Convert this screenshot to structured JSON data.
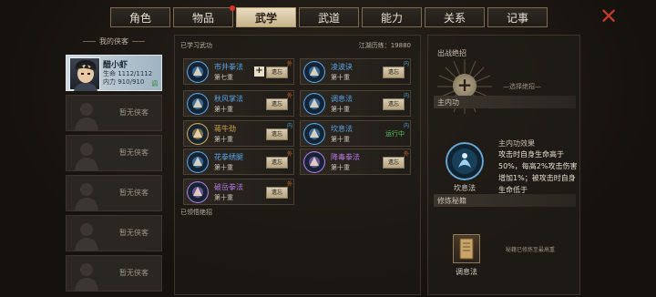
{
  "tabs": [
    {
      "label": "角色",
      "active": false
    },
    {
      "label": "物品",
      "active": false,
      "notify": true
    },
    {
      "label": "武学",
      "active": true
    },
    {
      "label": "武道",
      "active": false
    },
    {
      "label": "能力",
      "active": false
    },
    {
      "label": "关系",
      "active": false
    },
    {
      "label": "记事",
      "active": false
    }
  ],
  "roster": {
    "title": "我的侠客",
    "hero": {
      "name": "醋小虾",
      "hp": "生命 1112/1112",
      "mp": "内力 910/910",
      "tag": "调"
    },
    "empty_label": "暂无侠客"
  },
  "skills_panel": {
    "header": "已学习武功",
    "stat": "江湖历练：19880",
    "forget_label": "遗忘",
    "wai_tag": "外",
    "nei_tag": "内",
    "skills": [
      {
        "name": "市井拳法",
        "level": "第七重",
        "type": "外",
        "color": "#5aa5e6",
        "status": "forget",
        "plus": true
      },
      {
        "name": "凌波诀",
        "level": "第十重",
        "type": "内",
        "color": "#5aa5e6",
        "status": "forget"
      },
      {
        "name": "秋风掌法",
        "level": "第十重",
        "type": "外",
        "color": "#5aa5e6",
        "status": "forget"
      },
      {
        "name": "调息法",
        "level": "第十重",
        "type": "内",
        "color": "#5aa5e6",
        "status": "forget"
      },
      {
        "name": "蒋牛劲",
        "level": "第十重",
        "type": "内",
        "color": "#d7a94a",
        "status": "forget"
      },
      {
        "name": "坎息法",
        "level": "第十重",
        "type": "内",
        "color": "#5aa5e6",
        "status": "running",
        "status_label": "运行中"
      },
      {
        "name": "花拳绣腿",
        "level": "第十重",
        "type": "外",
        "color": "#5aa5e6",
        "status": "forget"
      },
      {
        "name": "降毒拳法",
        "level": "第十重",
        "type": "外",
        "color": "#b779e6",
        "status": "forget"
      },
      {
        "name": "破岳拳法",
        "level": "第十重",
        "type": "外",
        "color": "#b779e6",
        "status": "forget"
      }
    ],
    "footer": "已领悟绝招"
  },
  "right_panel": {
    "passive_title": "出战绝招",
    "passive_hint": "—选择绝招—",
    "inner_title": "主内功",
    "inner_effect_title": "主内功效果",
    "inner_effect_text": "攻击时自身生命高于50%，每高2%攻击伤害增加1%；被攻击时自身生命低于",
    "inner_name": "坎息法",
    "book_title": "修炼秘籍",
    "book_name": "调息法",
    "book_hint": "秘籍已修炼至最高重"
  },
  "colors": {
    "accent_tab": "#c7b48d",
    "skill_blue": "#5aa5e6",
    "skill_gold": "#d7a94a",
    "skill_purple": "#b779e6",
    "running_green": "#5ac25a",
    "close_red": "#c43a2b"
  },
  "icons": {
    "close": "close-x-icon",
    "plus": "plus-icon",
    "book": "scroll-book-icon"
  }
}
